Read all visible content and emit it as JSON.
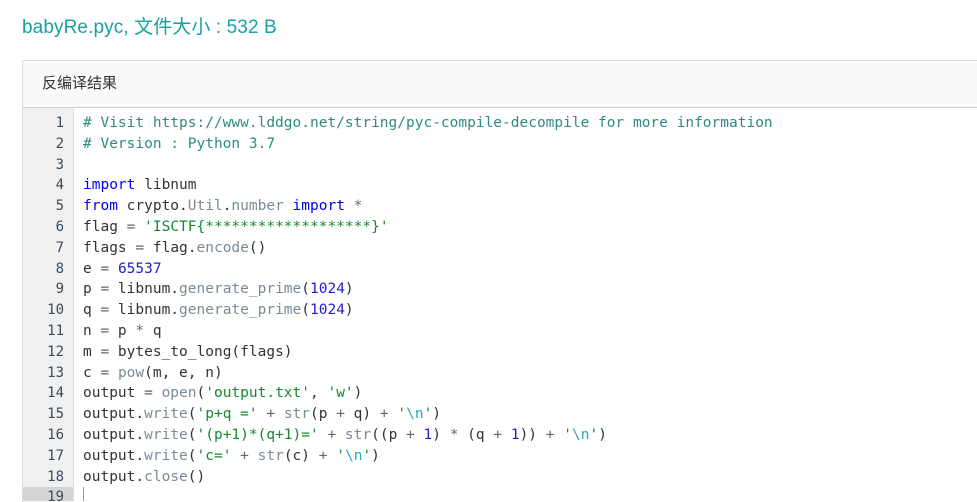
{
  "page_title": "babyRe.pyc, 文件大小 : 532 B",
  "accent_color": "#17a2a0",
  "panel": {
    "header_title": "反编译结果"
  },
  "editor": {
    "active_line": 19,
    "line_numbers": [
      "1",
      "2",
      "3",
      "4",
      "5",
      "6",
      "7",
      "8",
      "9",
      "10",
      "11",
      "12",
      "13",
      "14",
      "15",
      "16",
      "17",
      "18",
      "19"
    ],
    "lines": [
      {
        "n": 1,
        "tokens": [
          {
            "t": "com",
            "v": "# Visit https://www.lddgo.net/string/pyc-compile-decompile for more information"
          }
        ]
      },
      {
        "n": 2,
        "tokens": [
          {
            "t": "com",
            "v": "# Version : Python 3.7"
          }
        ]
      },
      {
        "n": 3,
        "tokens": []
      },
      {
        "n": 4,
        "tokens": [
          {
            "t": "kw",
            "v": "import"
          },
          {
            "t": "pl",
            "v": " libnum"
          }
        ]
      },
      {
        "n": 5,
        "tokens": [
          {
            "t": "kw",
            "v": "from"
          },
          {
            "t": "pl",
            "v": " crypto."
          },
          {
            "t": "fn",
            "v": "Util"
          },
          {
            "t": "pl",
            "v": "."
          },
          {
            "t": "fn",
            "v": "number"
          },
          {
            "t": "pl",
            "v": " "
          },
          {
            "t": "kw",
            "v": "import"
          },
          {
            "t": "op",
            "v": " *"
          }
        ]
      },
      {
        "n": 6,
        "tokens": [
          {
            "t": "pl",
            "v": "flag "
          },
          {
            "t": "op",
            "v": "="
          },
          {
            "t": "pl",
            "v": " "
          },
          {
            "t": "str",
            "v": "'ISCTF{*******************}'"
          }
        ]
      },
      {
        "n": 7,
        "tokens": [
          {
            "t": "pl",
            "v": "flags "
          },
          {
            "t": "op",
            "v": "="
          },
          {
            "t": "pl",
            "v": " flag."
          },
          {
            "t": "fn",
            "v": "encode"
          },
          {
            "t": "pl",
            "v": "()"
          }
        ]
      },
      {
        "n": 8,
        "tokens": [
          {
            "t": "pl",
            "v": "e "
          },
          {
            "t": "op",
            "v": "="
          },
          {
            "t": "pl",
            "v": " "
          },
          {
            "t": "num",
            "v": "65537"
          }
        ]
      },
      {
        "n": 9,
        "tokens": [
          {
            "t": "pl",
            "v": "p "
          },
          {
            "t": "op",
            "v": "="
          },
          {
            "t": "pl",
            "v": " libnum."
          },
          {
            "t": "fn",
            "v": "generate_prime"
          },
          {
            "t": "pl",
            "v": "("
          },
          {
            "t": "num",
            "v": "1024"
          },
          {
            "t": "pl",
            "v": ")"
          }
        ]
      },
      {
        "n": 10,
        "tokens": [
          {
            "t": "pl",
            "v": "q "
          },
          {
            "t": "op",
            "v": "="
          },
          {
            "t": "pl",
            "v": " libnum."
          },
          {
            "t": "fn",
            "v": "generate_prime"
          },
          {
            "t": "pl",
            "v": "("
          },
          {
            "t": "num",
            "v": "1024"
          },
          {
            "t": "pl",
            "v": ")"
          }
        ]
      },
      {
        "n": 11,
        "tokens": [
          {
            "t": "pl",
            "v": "n "
          },
          {
            "t": "op",
            "v": "="
          },
          {
            "t": "pl",
            "v": " p "
          },
          {
            "t": "op",
            "v": "*"
          },
          {
            "t": "pl",
            "v": " q"
          }
        ]
      },
      {
        "n": 12,
        "tokens": [
          {
            "t": "pl",
            "v": "m "
          },
          {
            "t": "op",
            "v": "="
          },
          {
            "t": "pl",
            "v": " bytes_to_long(flags)"
          }
        ]
      },
      {
        "n": 13,
        "tokens": [
          {
            "t": "pl",
            "v": "c "
          },
          {
            "t": "op",
            "v": "="
          },
          {
            "t": "pl",
            "v": " "
          },
          {
            "t": "fn",
            "v": "pow"
          },
          {
            "t": "pl",
            "v": "(m, e, n)"
          }
        ]
      },
      {
        "n": 14,
        "tokens": [
          {
            "t": "pl",
            "v": "output "
          },
          {
            "t": "op",
            "v": "="
          },
          {
            "t": "pl",
            "v": " "
          },
          {
            "t": "fn",
            "v": "open"
          },
          {
            "t": "pl",
            "v": "("
          },
          {
            "t": "str",
            "v": "'output.txt'"
          },
          {
            "t": "pl",
            "v": ", "
          },
          {
            "t": "str",
            "v": "'w'"
          },
          {
            "t": "pl",
            "v": ")"
          }
        ]
      },
      {
        "n": 15,
        "tokens": [
          {
            "t": "pl",
            "v": "output."
          },
          {
            "t": "fn",
            "v": "write"
          },
          {
            "t": "pl",
            "v": "("
          },
          {
            "t": "str",
            "v": "'p+q ='"
          },
          {
            "t": "op",
            "v": " + "
          },
          {
            "t": "fn",
            "v": "str"
          },
          {
            "t": "pl",
            "v": "(p "
          },
          {
            "t": "op",
            "v": "+"
          },
          {
            "t": "pl",
            "v": " q)"
          },
          {
            "t": "op",
            "v": " + "
          },
          {
            "t": "str",
            "v": "'"
          },
          {
            "t": "esc",
            "v": "\\n"
          },
          {
            "t": "str",
            "v": "'"
          },
          {
            "t": "pl",
            "v": ")"
          }
        ]
      },
      {
        "n": 16,
        "tokens": [
          {
            "t": "pl",
            "v": "output."
          },
          {
            "t": "fn",
            "v": "write"
          },
          {
            "t": "pl",
            "v": "("
          },
          {
            "t": "str",
            "v": "'(p+1)*(q+1)='"
          },
          {
            "t": "op",
            "v": " + "
          },
          {
            "t": "fn",
            "v": "str"
          },
          {
            "t": "pl",
            "v": "((p "
          },
          {
            "t": "op",
            "v": "+"
          },
          {
            "t": "pl",
            "v": " "
          },
          {
            "t": "num",
            "v": "1"
          },
          {
            "t": "pl",
            "v": ") "
          },
          {
            "t": "op",
            "v": "*"
          },
          {
            "t": "pl",
            "v": " (q "
          },
          {
            "t": "op",
            "v": "+"
          },
          {
            "t": "pl",
            "v": " "
          },
          {
            "t": "num",
            "v": "1"
          },
          {
            "t": "pl",
            "v": "))"
          },
          {
            "t": "op",
            "v": " + "
          },
          {
            "t": "str",
            "v": "'"
          },
          {
            "t": "esc",
            "v": "\\n"
          },
          {
            "t": "str",
            "v": "'"
          },
          {
            "t": "pl",
            "v": ")"
          }
        ]
      },
      {
        "n": 17,
        "tokens": [
          {
            "t": "pl",
            "v": "output."
          },
          {
            "t": "fn",
            "v": "write"
          },
          {
            "t": "pl",
            "v": "("
          },
          {
            "t": "str",
            "v": "'c='"
          },
          {
            "t": "op",
            "v": " + "
          },
          {
            "t": "fn",
            "v": "str"
          },
          {
            "t": "pl",
            "v": "(c)"
          },
          {
            "t": "op",
            "v": " + "
          },
          {
            "t": "str",
            "v": "'"
          },
          {
            "t": "esc",
            "v": "\\n"
          },
          {
            "t": "str",
            "v": "'"
          },
          {
            "t": "pl",
            "v": ")"
          }
        ]
      },
      {
        "n": 18,
        "tokens": [
          {
            "t": "pl",
            "v": "output."
          },
          {
            "t": "fn",
            "v": "close"
          },
          {
            "t": "pl",
            "v": "()"
          }
        ]
      },
      {
        "n": 19,
        "tokens": []
      }
    ]
  },
  "colors": {
    "comment": "#2e8b83",
    "keyword": "#0000ee",
    "string": "#138a2e",
    "escape": "#2aa8c4",
    "number": "#2020d0",
    "function": "#7a8a9a",
    "gutter_bg": "#f0f0f0",
    "active_line_bg": "#d4d4d4"
  }
}
